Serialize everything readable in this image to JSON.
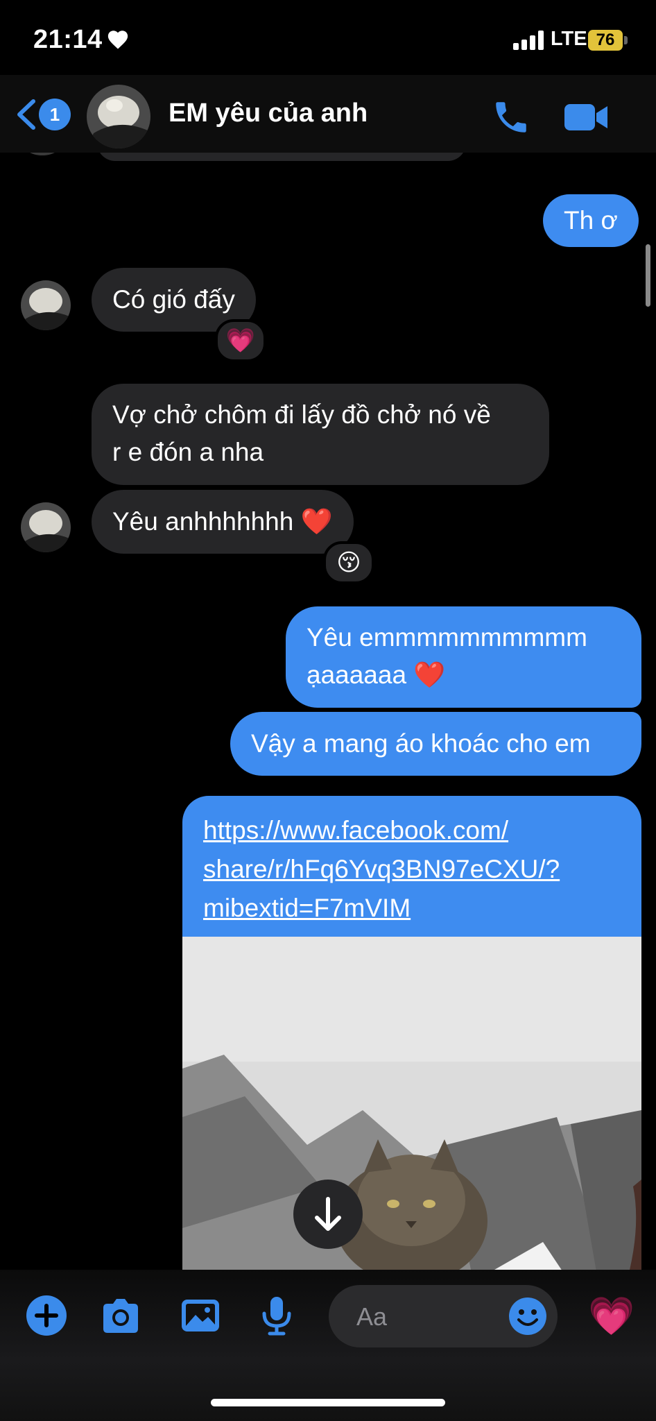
{
  "status_bar": {
    "time": "21:14",
    "network": "LTE",
    "battery": "76"
  },
  "header": {
    "back_badge": "1",
    "contact_name": "EM yêu của anh"
  },
  "messages": [
    {
      "direction": "outgoing",
      "text": "Th ơ"
    },
    {
      "direction": "incoming",
      "text": "Có gió đấy",
      "reaction": "💗"
    },
    {
      "direction": "incoming",
      "line1": "Vợ chở chôm đi lấy đồ chở nó về",
      "line2": "r e đón a nha"
    },
    {
      "direction": "incoming",
      "text": "Yêu anhhhhhhh ❤️",
      "reaction": "😚"
    },
    {
      "direction": "outgoing",
      "line1": "Yêu emmmmmmmmmm",
      "line2": "ạaaaaaa ❤️"
    },
    {
      "direction": "outgoing",
      "text": "Vậy a mang áo khoác cho em"
    },
    {
      "direction": "outgoing",
      "type": "link",
      "line1": "https://www.facebook.com/",
      "line2": "share/r/hFq6Yvq3BN97eCXU/?",
      "line3": "mibextid=F7mVIM"
    }
  ],
  "composer": {
    "placeholder": "Aa",
    "send_emoji": "💗"
  },
  "colors": {
    "accent": "#3e8cf0",
    "incoming_bubble": "#262628",
    "background": "#000000",
    "battery": "#e2c33a"
  },
  "icons": [
    "heart-icon",
    "signal-icon",
    "battery-icon",
    "back-chevron-icon",
    "phone-icon",
    "video-camera-icon",
    "arrow-down-icon",
    "plus-icon",
    "camera-icon",
    "image-icon",
    "microphone-icon",
    "emoji-icon"
  ]
}
